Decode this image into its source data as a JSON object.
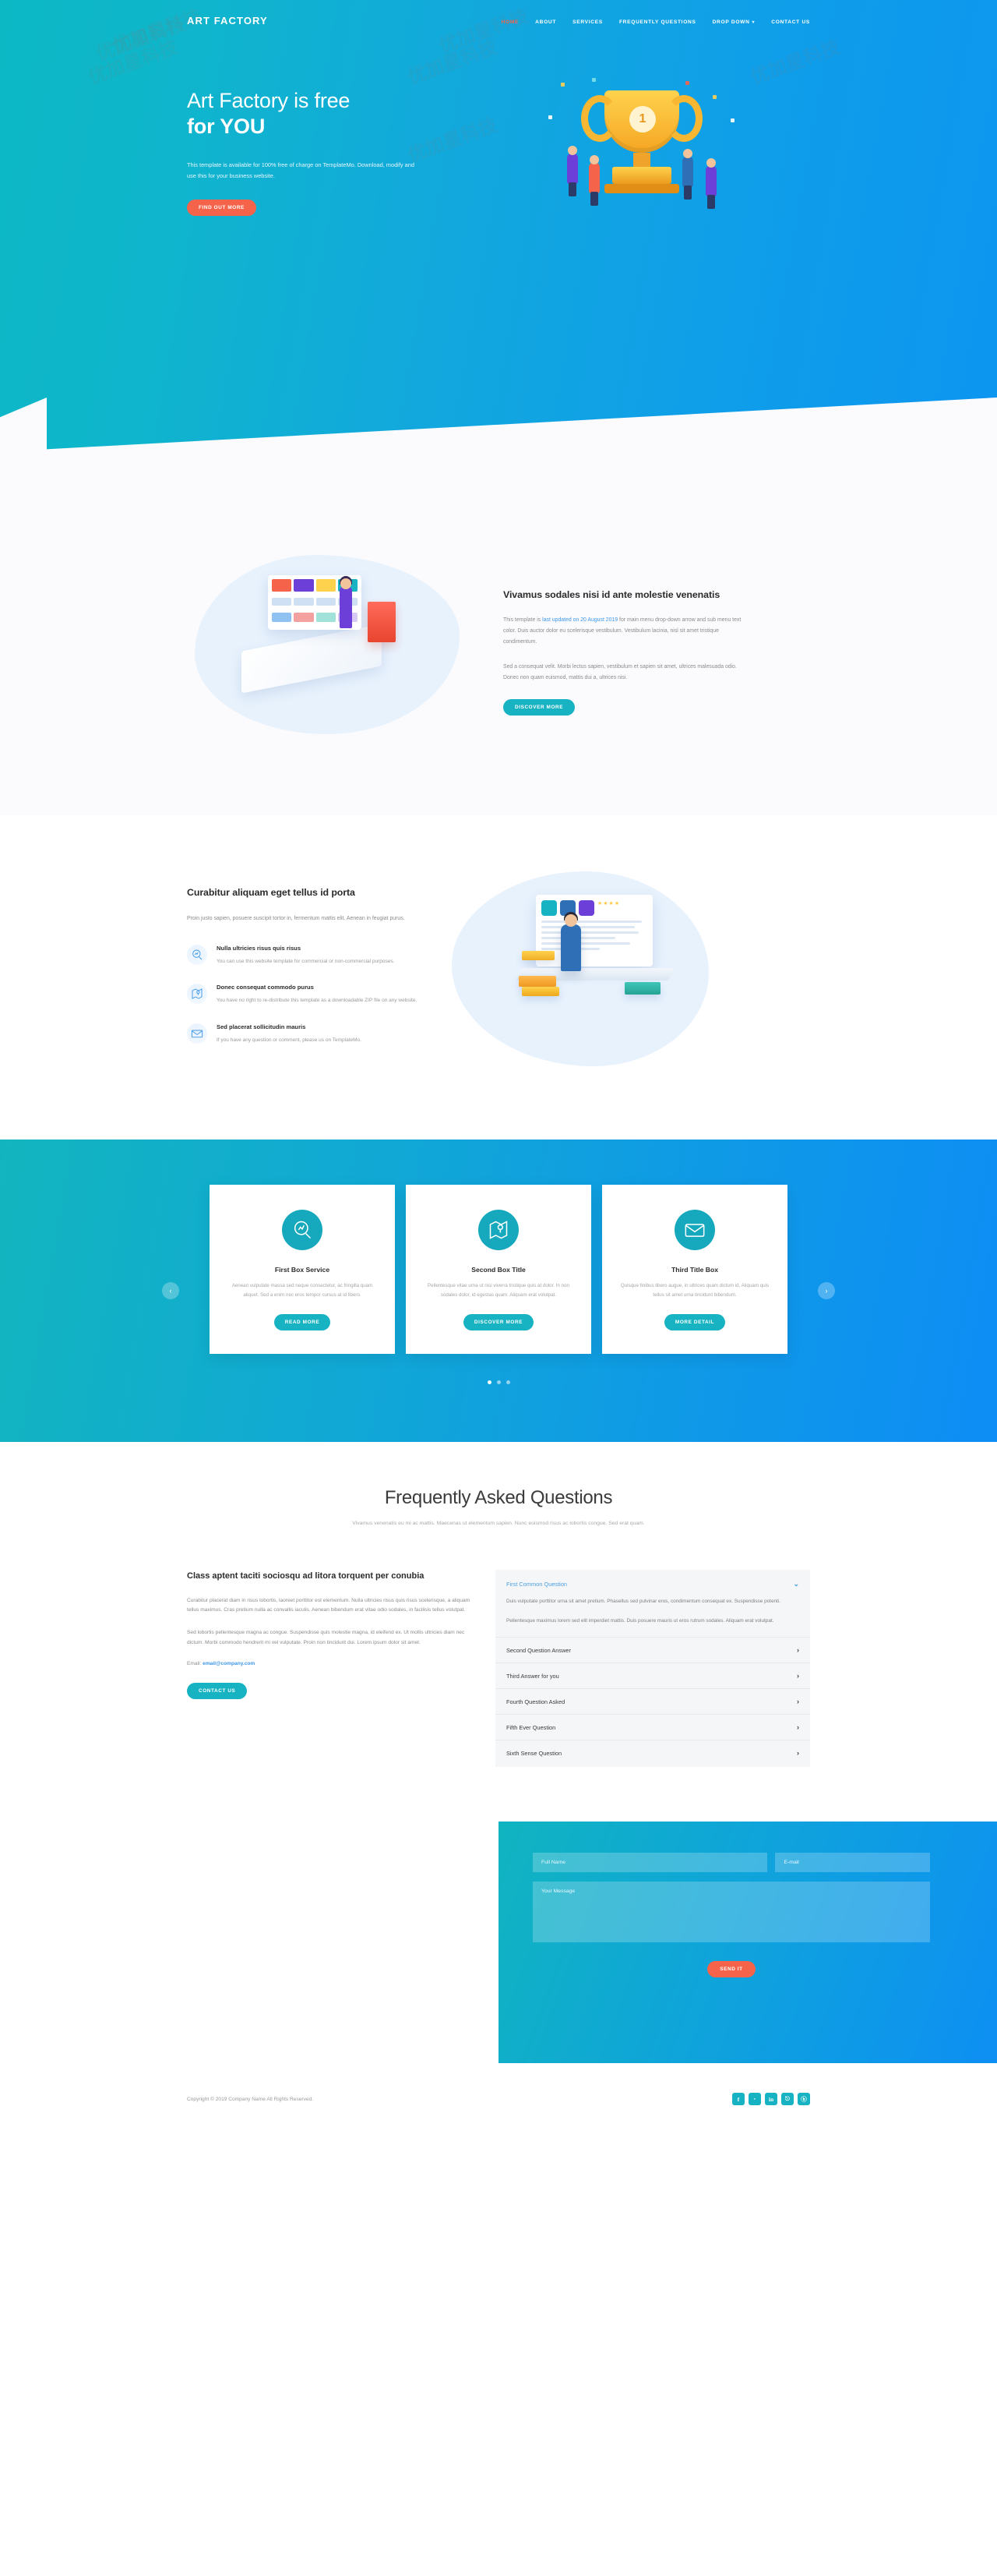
{
  "header": {
    "logo": "ART FACTORY",
    "nav": [
      {
        "label": "Home",
        "active": true
      },
      {
        "label": "About",
        "active": false
      },
      {
        "label": "Services",
        "active": false
      },
      {
        "label": "Frequently Questions",
        "active": false
      },
      {
        "label": "Drop Down",
        "active": false,
        "caret": "⌄"
      },
      {
        "label": "Contact Us",
        "active": false
      }
    ],
    "active_color": "#f5634a"
  },
  "hero": {
    "title_line1": "Art Factory is free",
    "title_line2": "for YOU",
    "paragraph": "This template is available for 100% free of charge on TemplateMo. Download, modify and use this for your business website.",
    "cta": "Find Out More",
    "trophy_number": "1"
  },
  "about": {
    "heading": "Vivamus sodales nisi id ante molestie venenatis",
    "p1_before": "This template is ",
    "p1_link": "last updated on 20 August 2019",
    "p1_after": " for main menu drop-down arrow and sub menu text color. Duis auctor dolor eu scelerisque vestibulum. Vestibulum lacinia, nisl sit amet tristique condimentum.",
    "p2": "Sed a consequat velit. Morbi lectus sapien, vestibulum et sapien sit amet, ultrices malesuada odio. Donec non quam euismod, mattis dui a, ultrices nisi.",
    "cta": "Discover More"
  },
  "features": {
    "heading": "Curabitur aliquam eget tellus id porta",
    "intro": "Proin justo sapien, posuere suscipit tortor in, fermentum mattis elit. Aenean in feugiat purus.",
    "items": [
      {
        "icon": "search-chart-icon",
        "title": "Nulla ultricies risus quis risus",
        "text": "You can use this website template for commercial or non-commercial purposes."
      },
      {
        "icon": "map-pin-icon",
        "title": "Donec consequat commodo purus",
        "text": "You have no right to re-distribute this template as a downloadable ZIP file on any website."
      },
      {
        "icon": "envelope-icon",
        "title": "Sed placerat sollicitudin mauris",
        "text": "If you have any question or comment, please us on TemplateMo."
      }
    ]
  },
  "services": {
    "prev": "‹",
    "next": "›",
    "cards": [
      {
        "icon": "search-chart-icon",
        "title": "First Box Service",
        "text": "Aenean vulputate massa sed neque consectetur, ac fringilla quam aliquet. Sed a enim nec eros tempor cursus at id libero.",
        "cta": "Read More"
      },
      {
        "icon": "map-pin-icon",
        "title": "Second Box Title",
        "text": "Pellentesque vitae urna ut nisi viverra tristique quis at dolor. In non sodales dolor, id egestas quam. Aliquam erat volutpat.",
        "cta": "Discover More"
      },
      {
        "icon": "envelope-icon",
        "title": "Third Title Box",
        "text": "Quisque finibus libero augue, in ultrices quam dictum id. Aliquam quis tellus sit amet urna tincidunt bibendum.",
        "cta": "More Detail"
      }
    ],
    "dots": [
      true,
      false,
      false
    ]
  },
  "faq": {
    "title": "Frequently Asked Questions",
    "subtitle": "Vivamus venenatis eu mi ac mattis. Maecenas ut elementum sapien. Nunc euismod risus ac lobortis congue. Sed erat quam.",
    "left_heading": "Class aptent taciti sociosqu ad litora torquent per conubia",
    "left_p1": "Curabitur placerat diam in risus lobortis, laoreet porttitor est elementum. Nulla ultricies risus quis risus scelerisque, a aliquam tellus maximus. Cras pretium nulla ac convallis iaculis. Aenean bibendum erat vitae odio sodales, in facilisis tellus volutpat.",
    "left_p2": "Sed lobortis pellentesque magna ac congue. Suspendisse quis molestie magna, id eleifend ex. Ut mollis ultricies diam nec dictum. Morbi commodo hendrerit mi vel vulputate. Proin non tincidunt dui. Lorem ipsum dolor sit amet.",
    "email_label": "Email: ",
    "email_value": "email@company.com",
    "cta": "Contact Us",
    "items": [
      {
        "question": "First Common Question",
        "open": true,
        "icon": "chevron-down-icon",
        "answer1": "Duis vulputate porttitor urna sit amet pretium. Phasellus sed pulvinar eros, condimentum consequat ex. Suspendisse potenti.",
        "answer2": "Pellentesque maximus lorem sed elit imperdiet mattis. Duis posuere mauris ut eros rutrum sodales. Aliquam erat volutpat."
      },
      {
        "question": "Second Question Answer",
        "open": false,
        "icon": "chevron-right-icon"
      },
      {
        "question": "Third Answer for you",
        "open": false,
        "icon": "chevron-right-icon"
      },
      {
        "question": "Fourth Question Asked",
        "open": false,
        "icon": "chevron-right-icon"
      },
      {
        "question": "Fifth Ever Question",
        "open": false,
        "icon": "chevron-right-icon"
      },
      {
        "question": "Sixth Sense Question",
        "open": false,
        "icon": "chevron-right-icon"
      }
    ]
  },
  "contact": {
    "name_placeholder": "Full Name",
    "email_placeholder": "E-mail",
    "message_placeholder": "Your Message",
    "name_value": "",
    "email_value": "",
    "message_value": "",
    "send_label": "Send It"
  },
  "footer": {
    "copyright": "Copyright © 2019 Company Name All Rights Reserved.",
    "socials": [
      {
        "name": "facebook-icon",
        "glyph": "f"
      },
      {
        "name": "twitter-icon",
        "glyph": "ᵛ"
      },
      {
        "name": "linkedin-icon",
        "glyph": "in"
      },
      {
        "name": "rss-icon",
        "glyph": "⎋"
      },
      {
        "name": "behance-icon",
        "glyph": "ⓑ"
      }
    ]
  },
  "theme": {
    "accent_red": "#f5634a",
    "accent_teal": "#17b3c3",
    "link_blue": "#3e97e8",
    "gradient_start": "#0cb8c4",
    "gradient_end": "#0d8df5"
  }
}
